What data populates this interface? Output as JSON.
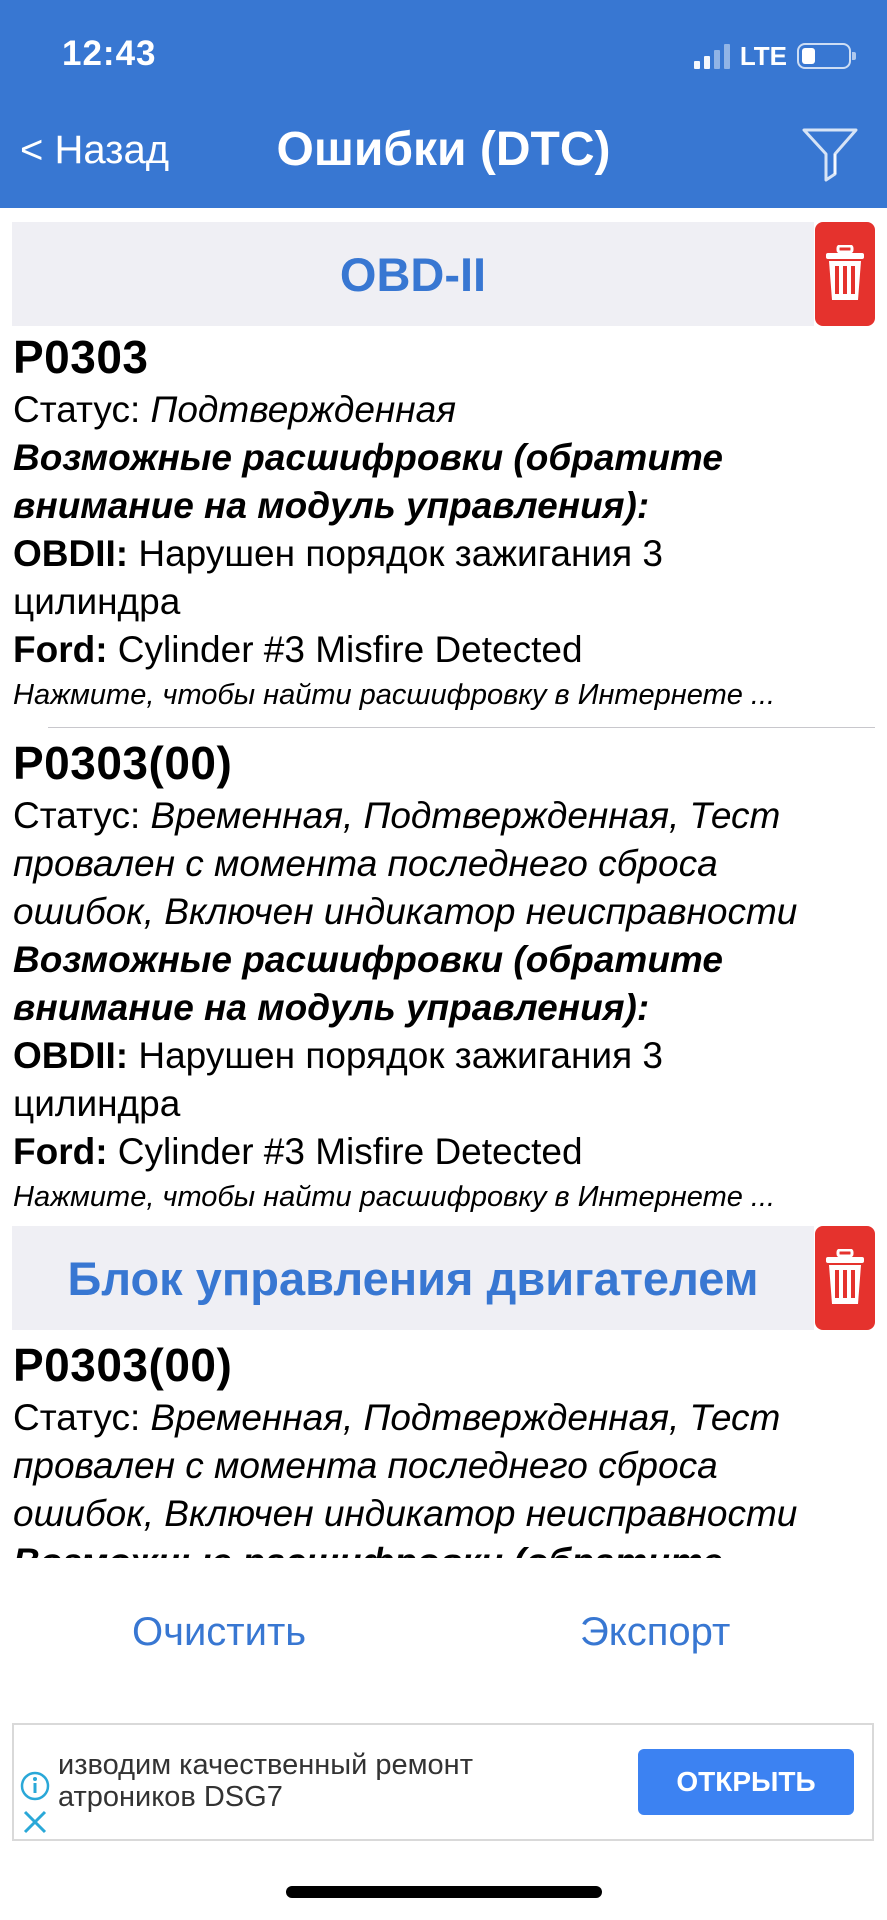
{
  "status_bar": {
    "time": "12:43",
    "network": "LTE",
    "signal_bars": 4,
    "signal_active": 2,
    "battery_level": 0.25
  },
  "nav": {
    "back_label": "< Назад",
    "title": "Ошибки (DTC)",
    "filter_icon": "filter-icon"
  },
  "sections": [
    {
      "title": "OBD-II",
      "delete_icon": "trash-icon"
    },
    {
      "title": "Блок управления двигателем",
      "delete_icon": "trash-icon"
    }
  ],
  "entries": [
    {
      "code": "P0303",
      "status_label": "Статус: ",
      "status_value": "Подтвержденная",
      "decode_heading_1": "Возможные расшифровки (обратите",
      "decode_heading_2": "внимание на модуль управления):",
      "obd_label": "OBDII:",
      "obd_text_1": " Нарушен порядок зажигания 3",
      "obd_text_2": "цилиндра",
      "ford_label": "Ford:",
      "ford_text": " Cylinder #3 Misfire Detected",
      "search_hint": "Нажмите, чтобы найти расшифровку в Интернете ..."
    },
    {
      "code": "P0303(00)",
      "status_label": "Статус: ",
      "status_value_1": "Временная, Подтвержденная, Тест",
      "status_value_2": "провален с момента последнего сброса",
      "status_value_3": "ошибок, Включен индикатор неисправности",
      "decode_heading_1": "Возможные расшифровки (обратите",
      "decode_heading_2": "внимание на модуль управления):",
      "obd_label": "OBDII:",
      "obd_text_1": " Нарушен порядок зажигания 3",
      "obd_text_2": "цилиндра",
      "ford_label": "Ford:",
      "ford_text": " Cylinder #3 Misfire Detected",
      "search_hint": "Нажмите, чтобы найти расшифровку в Интернете ..."
    },
    {
      "code": "P0303(00)",
      "status_label": "Статус: ",
      "status_value_1": "Временная, Подтвержденная, Тест",
      "status_value_2": "провален с момента последнего сброса",
      "status_value_3": "ошибок, Включен индикатор неисправности",
      "decode_heading_1": "Возможные расшифровки (обратите"
    }
  ],
  "actions": {
    "clear_label": "Очистить",
    "export_label": "Экспорт"
  },
  "ad": {
    "line_1": "изводим качественный ремонт",
    "line_2": "атроников DSG7",
    "open_label": "ОТКРЫТЬ"
  },
  "colors": {
    "accent": "#3877d2",
    "danger": "#e5322d",
    "section_bg": "#efeff4"
  }
}
